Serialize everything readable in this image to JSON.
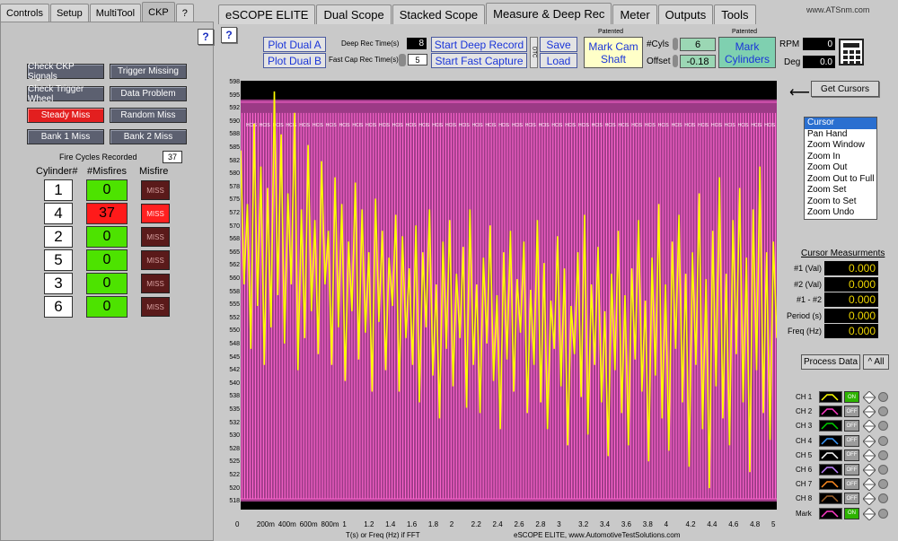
{
  "left_tabs": [
    "Controls",
    "Setup",
    "MultiTool",
    "CKP",
    "?"
  ],
  "main_tabs": [
    "eSCOPE ELITE",
    "Dual Scope",
    "Stacked Scope",
    "Measure & Deep Rec",
    "Meter",
    "Outputs",
    "Tools"
  ],
  "website": "www.ATSnm.com",
  "help": "?",
  "ckp_buttons": [
    "Check CKP Signals",
    "Trigger Missing",
    "Check Trigger Wheel",
    "Data Problem",
    "Steady Miss",
    "Random Miss",
    "Bank 1 Miss",
    "Bank 2 Miss"
  ],
  "fire_cycles_label": "Fire Cycles Recorded",
  "fire_cycles_value": "37",
  "table_headers": [
    "Cylinder#",
    "#Misfires",
    "Misfire"
  ],
  "cylinders": [
    {
      "cyl": "1",
      "misfires": "0",
      "miss": "MISS",
      "active": false
    },
    {
      "cyl": "4",
      "misfires": "37",
      "miss": "MISS",
      "active": true
    },
    {
      "cyl": "2",
      "misfires": "0",
      "miss": "MISS",
      "active": false
    },
    {
      "cyl": "5",
      "misfires": "0",
      "miss": "MISS",
      "active": false
    },
    {
      "cyl": "3",
      "misfires": "0",
      "miss": "MISS",
      "active": false
    },
    {
      "cyl": "6",
      "misfires": "0",
      "miss": "MISS",
      "active": false
    }
  ],
  "toolbar": {
    "plot_dual_a": "Plot Dual A",
    "plot_dual_b": "Plot Dual B",
    "deep_rec_label": "Deep Rec Time(s)",
    "deep_rec_value": "8",
    "fast_cap_label": "Fast Cap Rec Time(s)",
    "fast_cap_value": "5",
    "start_deep": "Start Deep Record",
    "start_fast": "Start Fast Capture",
    "save": "Save",
    "load": "Load",
    "dtc": "DTC",
    "patented1": "Patented",
    "mark_cam": "Mark Cam Shaft",
    "cyls_label": "#Cyls",
    "cyls_value": "6",
    "offset_label": "Offset",
    "offset_value": "-0.18",
    "patented2": "Patented",
    "mark_cyl": "Mark Cylinders",
    "rpm_label": "RPM",
    "rpm_value": "0",
    "deg_label": "Deg",
    "deg_value": "0.0"
  },
  "get_cursors": "Get Cursors",
  "cursor_menu": [
    "Cursor",
    "Pan Hand",
    "Zoom Window",
    "Zoom In",
    "Zoom Out",
    "Zoom Out to Full",
    "Zoom Set",
    "Zoom to Set",
    "Zoom Undo"
  ],
  "measurements_title": "Cursor Measurments",
  "measurements": [
    {
      "label": "#1 (Val)",
      "value": "0.000"
    },
    {
      "label": "#2 (Val)",
      "value": "0.000"
    },
    {
      "label": "#1 - #2",
      "value": "0.000"
    },
    {
      "label": "Period (s)",
      "value": "0.000"
    },
    {
      "label": "Freq (Hz)",
      "value": "0.000"
    }
  ],
  "process_data": "Process Data",
  "all_button": "^ All",
  "channels": [
    {
      "name": "CH 1",
      "state": "ON",
      "color": "#ffff00"
    },
    {
      "name": "CH 2",
      "state": "OFF",
      "color": "#ff3ac8"
    },
    {
      "name": "CH 3",
      "state": "OFF",
      "color": "#00d000"
    },
    {
      "name": "CH 4",
      "state": "OFF",
      "color": "#3a9aff"
    },
    {
      "name": "CH 5",
      "state": "OFF",
      "color": "#ffffff"
    },
    {
      "name": "CH 6",
      "state": "OFF",
      "color": "#c080ff"
    },
    {
      "name": "CH 7",
      "state": "OFF",
      "color": "#ff8a20"
    },
    {
      "name": "CH 8",
      "state": "OFF",
      "color": "#a0622a"
    },
    {
      "name": "Mark",
      "state": "ON",
      "color": "#ff3ac8"
    }
  ],
  "chart_data": {
    "type": "line",
    "xlabel": "T(s) or Freq (Hz) if FFT",
    "footer": "eSCOPE ELITE, www.AutomotiveTestSolutions.com",
    "ylim": [
      518,
      598
    ],
    "xlim": [
      0,
      5
    ],
    "y_ticks": [
      "598",
      "595",
      "592",
      "590",
      "588",
      "585",
      "582",
      "580",
      "578",
      "575",
      "572",
      "570",
      "568",
      "565",
      "562",
      "560",
      "558",
      "555",
      "552",
      "550",
      "548",
      "545",
      "542",
      "540",
      "538",
      "535",
      "532",
      "530",
      "528",
      "525",
      "522",
      "520",
      "518"
    ],
    "x_ticks": [
      "0",
      "200m",
      "400m",
      "600m",
      "800m",
      "1",
      "1.2",
      "1.4",
      "1.6",
      "1.8",
      "2",
      "2.2",
      "2.4",
      "2.6",
      "2.8",
      "3",
      "3.2",
      "3.4",
      "3.6",
      "3.8",
      "4",
      "4.2",
      "4.4",
      "4.6",
      "4.8",
      "5"
    ],
    "mark_top_label": "HCIS",
    "series": [
      {
        "name": "CH 1",
        "color": "#ffff00",
        "y": [
          585,
          560,
          575,
          548,
          590,
          556,
          582,
          545,
          578,
          552,
          596,
          558,
          588,
          549,
          577,
          560,
          592,
          544,
          574,
          550,
          586,
          555,
          572,
          547,
          583,
          560,
          570,
          545,
          580,
          552,
          575,
          542,
          568,
          555,
          579,
          546,
          574,
          551,
          566,
          540,
          576,
          553,
          570,
          544,
          565,
          556,
          573,
          540,
          569,
          550,
          563,
          545,
          571,
          538,
          566,
          552,
          574,
          543,
          560,
          535,
          568,
          548,
          572,
          541,
          562,
          550,
          567,
          537,
          574,
          545,
          560,
          536,
          565,
          549,
          571,
          542,
          558,
          533,
          566,
          546,
          570,
          540,
          561,
          551,
          568,
          536,
          559,
          545,
          572,
          538,
          564,
          533,
          557,
          548,
          569,
          541,
          563,
          530,
          556,
          547,
          566,
          539,
          573,
          532,
          560,
          545,
          567,
          538,
          555,
          528,
          562,
          544,
          570,
          536,
          558,
          530,
          563,
          546,
          572,
          540,
          557,
          527,
          565,
          543,
          575,
          535,
          560,
          529,
          568,
          548,
          573,
          538,
          562,
          526,
          566,
          545,
          577,
          533,
          561,
          522,
          570,
          541,
          580,
          535,
          562,
          530,
          572,
          547,
          578,
          538,
          565,
          525,
          574,
          544,
          582,
          536,
          566,
          531,
          568,
          550
        ]
      }
    ]
  }
}
